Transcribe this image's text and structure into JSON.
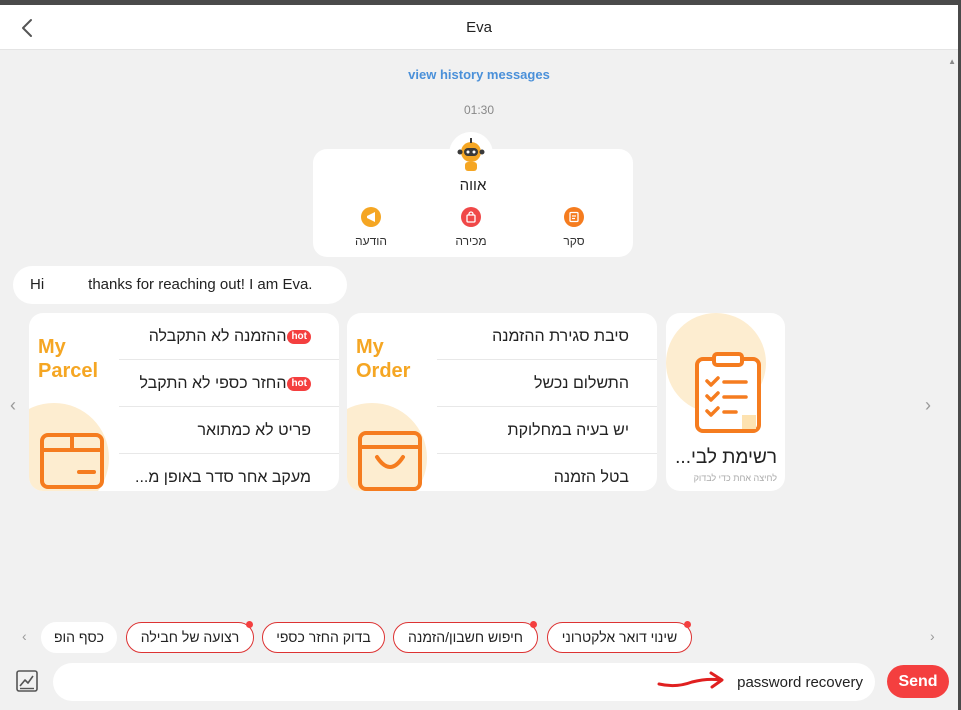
{
  "header": {
    "title": "Eva",
    "back_icon": "chevron-left-icon"
  },
  "chat": {
    "history_link": "view history messages",
    "timestamp": "01:30",
    "bot": {
      "name": "אווה",
      "avatar_icon": "robot-avatar-icon",
      "actions": [
        {
          "label": "הודעה",
          "icon": "megaphone-icon",
          "color": "#f5a623"
        },
        {
          "label": "מכירה",
          "icon": "shopping-bag-icon",
          "color": "#f04848"
        },
        {
          "label": "סקר",
          "icon": "survey-icon",
          "color": "#f57c1f"
        }
      ]
    },
    "greeting": {
      "hi": "Hi",
      "text": "thanks for reaching out! I am Eva."
    }
  },
  "cards": {
    "parcel": {
      "brand_line1": "My",
      "brand_line2": "Parcel",
      "icon": "parcel-box-icon",
      "items": [
        {
          "label": "ההזמנה לא התקבלה",
          "badge": "hot"
        },
        {
          "label": "החזר כספי לא התקבל",
          "badge": "hot"
        },
        {
          "label": "פריט לא כמתואר",
          "badge": ""
        },
        {
          "label": "מעקב אחר סדר באופן מ...",
          "badge": ""
        }
      ]
    },
    "order": {
      "brand_line1": "My",
      "brand_line2": "Order",
      "icon": "shopping-basket-icon",
      "items": [
        {
          "label": "סיבת סגירת ההזמנה"
        },
        {
          "label": "התשלום נכשל"
        },
        {
          "label": "יש בעיה במחלוקת"
        },
        {
          "label": "בטל הזמנה"
        }
      ]
    },
    "checklist": {
      "title": "רשימת לבי...",
      "subtitle": "לחיצה אחת כדי לבדוק",
      "icon": "clipboard-checklist-icon"
    }
  },
  "quick_replies": [
    {
      "label": "שינוי דואר אלקטרוני",
      "dot": true
    },
    {
      "label": "חיפוש חשבון/הזמנה",
      "dot": true
    },
    {
      "label": "בדוק החזר כספי",
      "dot": false
    },
    {
      "label": "רצועה של חבילה",
      "dot": true
    },
    {
      "label": "כסף הופ",
      "dot": false
    }
  ],
  "composer": {
    "value": "password recovery",
    "send_label": "Send",
    "gallery_icon": "image-gallery-icon"
  },
  "colors": {
    "accent": "#f43f3f",
    "brand_orange": "#f5a623",
    "link": "#4a90d9"
  }
}
